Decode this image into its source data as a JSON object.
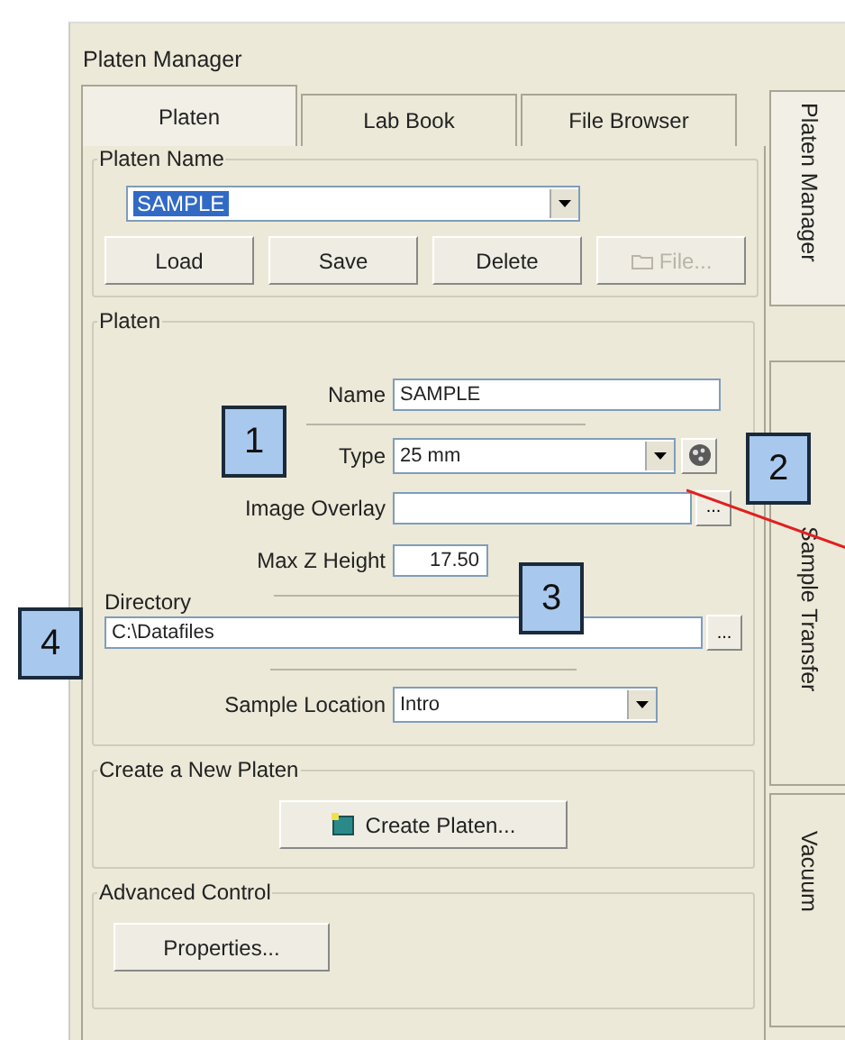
{
  "window": {
    "title": "Platen Manager"
  },
  "tabs": [
    {
      "label": "Platen",
      "selected": true
    },
    {
      "label": "Lab Book",
      "selected": false
    },
    {
      "label": "File Browser",
      "selected": false
    }
  ],
  "side_tabs": [
    {
      "label": "Platen Manager",
      "selected": true
    },
    {
      "label": "Sample Transfer",
      "selected": false
    },
    {
      "label": "Vacuum",
      "selected": false
    }
  ],
  "platen_name": {
    "legend": "Platen Name",
    "value": "SAMPLE",
    "buttons": [
      {
        "label": "Load",
        "disabled": false
      },
      {
        "label": "Save",
        "disabled": false
      },
      {
        "label": "Delete",
        "disabled": false
      },
      {
        "label": "File...",
        "disabled": true
      }
    ]
  },
  "platen": {
    "legend": "Platen",
    "name_label": "Name",
    "name_value": "SAMPLE",
    "type_label": "Type",
    "type_value": "25 mm",
    "overlay_label": "Image Overlay",
    "overlay_browse": "...",
    "max_z_label": "Max Z Height",
    "max_z_value": "17.50",
    "directory_label": "Directory",
    "directory_value": "C:\\Datafiles",
    "directory_browse": "...",
    "location_label": "Sample Location",
    "location_value": "Intro"
  },
  "create": {
    "legend": "Create a New Platen",
    "button": "Create Platen..."
  },
  "advanced": {
    "legend": "Advanced Control",
    "button": "Properties..."
  },
  "callouts": [
    {
      "label": "1"
    },
    {
      "label": "2"
    },
    {
      "label": "3"
    },
    {
      "label": "4"
    }
  ]
}
